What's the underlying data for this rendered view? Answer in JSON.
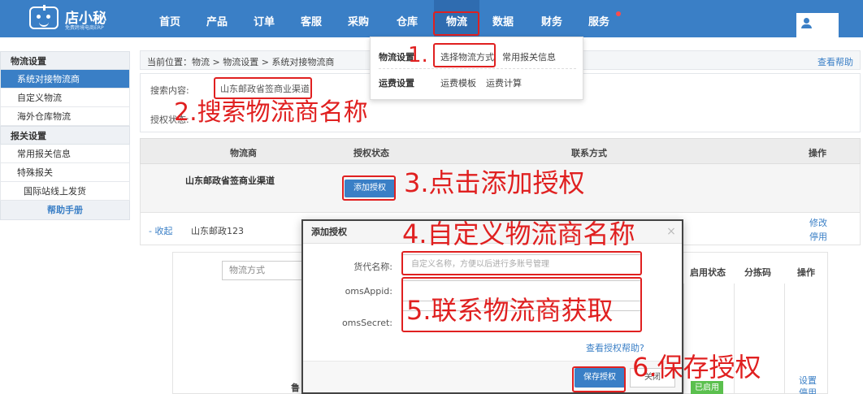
{
  "app": {
    "logo_title": "店小秘",
    "logo_subtitle": "免费跨境电商ERP"
  },
  "nav": {
    "items": [
      {
        "label": "首页"
      },
      {
        "label": "产品"
      },
      {
        "label": "订单"
      },
      {
        "label": "客服"
      },
      {
        "label": "采购"
      },
      {
        "label": "仓库"
      },
      {
        "label": "物流"
      },
      {
        "label": "数据"
      },
      {
        "label": "财务"
      },
      {
        "label": "服务"
      }
    ],
    "active": "物流"
  },
  "sidebar": {
    "group1": "物流设置",
    "items1": [
      "系统对接物流商",
      "自定义物流",
      "海外仓库物流"
    ],
    "group2": "报关设置",
    "items2": [
      "常用报关信息",
      "特殊报关",
      "国际站线上发货"
    ],
    "help": "帮助手册"
  },
  "breadcrumb": {
    "text": "当前位置：物流 > 物流设置 > 系统对接物流商",
    "help": "查看帮助"
  },
  "search": {
    "label": "搜索内容:",
    "value": "山东邮政省签商业渠道",
    "auth_label": "授权状态:"
  },
  "table": {
    "headers": [
      "物流商",
      "授权状态",
      "联系方式",
      "操作"
    ],
    "row1": {
      "name": "山东邮政省签商业渠道",
      "button": "添加授权"
    },
    "row2": {
      "collapse": "- 收起",
      "name": "山东邮政123",
      "op1": "修改",
      "op2": "停用"
    }
  },
  "sub_panel": {
    "method_placeholder": "物流方式",
    "headers": [
      "启用状态",
      "分拣码",
      "操作"
    ],
    "name_truncated": "鲁",
    "status_badge": "已启用",
    "op1": "设置",
    "op2": "停用"
  },
  "dropdown": {
    "group1": "物流设置",
    "group1_items": [
      "选择物流方式",
      "常用报关信息"
    ],
    "group2": "运费设置",
    "group2_items": [
      "运费模板",
      "运费计算"
    ]
  },
  "modal": {
    "title": "添加授权",
    "close": "×",
    "fields": [
      {
        "label": "货代名称:",
        "placeholder": "自定义名称，方便以后进行多账号管理"
      },
      {
        "label": "omsAppid:",
        "placeholder": ""
      },
      {
        "label": "omsSecret:",
        "placeholder": ""
      }
    ],
    "help_link": "查看授权帮助?",
    "save": "保存授权",
    "cancel": "关闭"
  },
  "annotations": {
    "a1": "1.",
    "a2": "2.搜索物流商名称",
    "a3": "3.点击添加授权",
    "a4": "4.自定义物流商名称",
    "a5": "5.联系物流商获取",
    "a6": "6.保存授权"
  },
  "colors": {
    "brand": "#3a7fc6",
    "annotation": "#e02020",
    "enabled": "#5bc04e"
  }
}
